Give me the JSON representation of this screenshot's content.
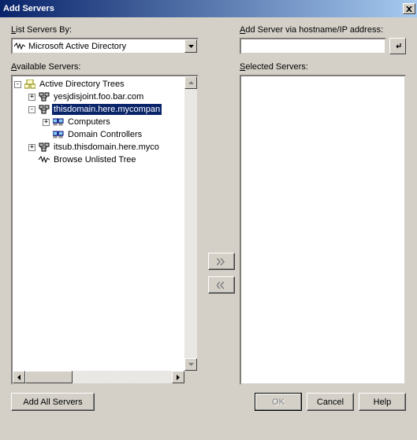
{
  "title": "Add Servers",
  "labels": {
    "list_by_prefix": "L",
    "list_by_rest": "ist Servers By:",
    "available_prefix": "A",
    "available_rest": "vailable Servers:",
    "addvia_prefix": "A",
    "addvia_rest": "dd Server via hostname/IP address:",
    "selected_prefix": "S",
    "selected_rest": "elected Servers:"
  },
  "combo": {
    "value": "Microsoft Active Directory"
  },
  "input": {
    "value": ""
  },
  "tree": {
    "root": "Active Directory Trees",
    "n1": "yesjdisjoint.foo.bar.com",
    "n2": "thisdomain.here.mycompan",
    "n2a": "Computers",
    "n2b": "Domain Controllers",
    "n3": "itsub.thisdomain.here.myco",
    "n4": "Browse Unlisted Tree"
  },
  "buttons": {
    "add_all_pre": "Add All S",
    "add_all_u": "e",
    "add_all_post": "rvers",
    "ok": "OK",
    "cancel": "Cancel",
    "help_u": "H",
    "help_post": "elp"
  }
}
